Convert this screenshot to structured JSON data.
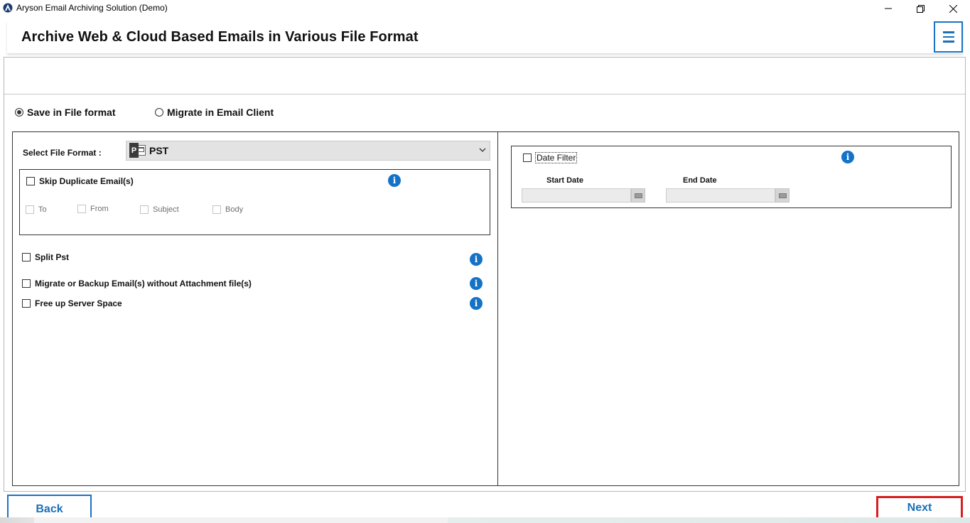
{
  "window": {
    "title": "Aryson Email Archiving Solution (Demo)",
    "controls": {
      "minimize": "—",
      "maximize": "❐",
      "close": "✕"
    }
  },
  "header": {
    "title": "Archive Web & Cloud Based Emails in Various File Format",
    "menu_icon": "hamburger-menu-icon"
  },
  "mode": {
    "save_label": "Save in File format",
    "migrate_label": "Migrate in Email Client",
    "selected": "save"
  },
  "left": {
    "select_format_label": "Select File Format :",
    "selected_format": "PST",
    "format_icon_letter": "P",
    "skip_duplicate_label": "Skip Duplicate Email(s)",
    "dup_fields": [
      "To",
      "From",
      "Subject",
      "Body"
    ],
    "options": [
      "Split Pst",
      "Migrate or Backup Email(s) without Attachment file(s)",
      "Free up Server Space"
    ]
  },
  "right": {
    "date_filter_label": "Date Filter",
    "start_date_label": "Start Date",
    "end_date_label": "End Date",
    "start_date_value": "",
    "end_date_value": ""
  },
  "info_glyph": "i",
  "buttons": {
    "back": "Back",
    "next": "Next"
  },
  "colors": {
    "accent_blue": "#1a73c4",
    "info_blue": "#1473c6",
    "highlight_red": "#d81e1e"
  }
}
